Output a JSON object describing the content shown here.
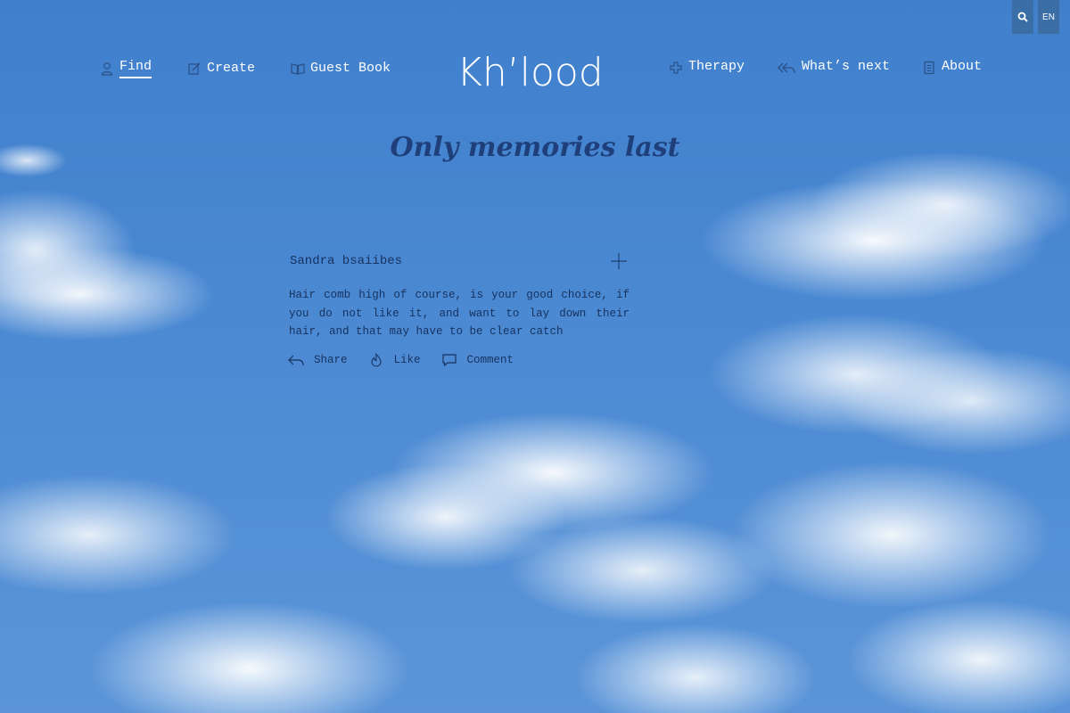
{
  "topbar": {
    "search_icon": "search-icon",
    "language": "EN"
  },
  "nav": {
    "left": [
      {
        "label": "Find",
        "icon": "user-icon",
        "active": true
      },
      {
        "label": "Create",
        "icon": "edit-icon"
      },
      {
        "label": "Guest Book",
        "icon": "book-icon"
      }
    ],
    "right": [
      {
        "label": "Therapy",
        "icon": "cross-icon"
      },
      {
        "label": "What’s next",
        "icon": "reply-all-icon"
      },
      {
        "label": "About",
        "icon": "document-icon"
      }
    ]
  },
  "logo": {
    "text": "Kh’lood"
  },
  "tagline": "Only memories last",
  "post": {
    "author": "Sandra bsaiibes",
    "text": "Hair comb high of course, is your good choice, if you do not like it, and want to lay down their hair, and that may have to be clear catch",
    "actions": {
      "share": "Share",
      "like": "Like",
      "comment": "Comment"
    }
  },
  "colors": {
    "sky": "#4a88d2",
    "topbar_button": "#3c6ea6",
    "tagline": "#1f3f7a",
    "post_text": "#16325f"
  }
}
